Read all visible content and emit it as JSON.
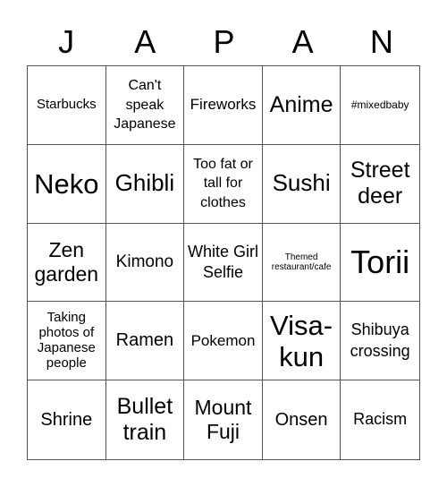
{
  "title_letters": [
    "J",
    "A",
    "P",
    "A",
    "N"
  ],
  "cells": [
    "Starbucks",
    "Can't speak Japanese",
    "Fireworks",
    "Anime",
    "#mixedbaby",
    "Neko",
    "Ghibli",
    "Too fat or tall for clothes",
    "Sushi",
    "Street deer",
    "Zen garden",
    "Kimono",
    "White Girl Selfie",
    "Themed restaurant/cafe",
    "Torii",
    "Taking photos of Japanese people",
    "Ramen",
    "Pokemon",
    "Visa-kun",
    "Shibuya crossing",
    "Shrine",
    "Bullet train",
    "Mount Fuji",
    "Onsen",
    "Racism"
  ]
}
